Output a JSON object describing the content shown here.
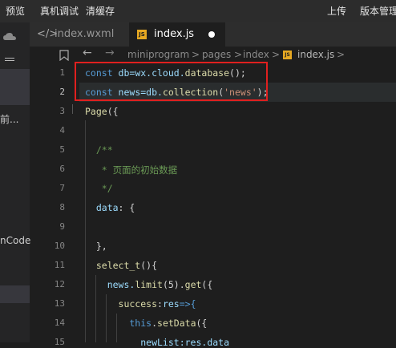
{
  "toolbar": {
    "preview": "预览",
    "remote_debug": "真机调试",
    "clear_cache": "清缓存",
    "upload": "上传",
    "version": "版本管理"
  },
  "left_panel": {
    "item1": "前...",
    "item2": "nCode"
  },
  "tabs": [
    {
      "label": "index.wxml",
      "icon": "wxml-file-icon"
    },
    {
      "label": "index.js",
      "icon": "js-file-icon",
      "active": true
    }
  ],
  "breadcrumb": {
    "segments": [
      "miniprogram",
      "pages",
      "index",
      "index.js"
    ],
    "sep": ">",
    "tail": ">"
  },
  "code": {
    "lines": [
      {
        "n": "1",
        "tokens": [
          {
            "t": "const ",
            "c": "kw"
          },
          {
            "t": "db=wx.cloud.",
            "c": "var"
          },
          {
            "t": "database",
            "c": "fn"
          },
          {
            "t": "();",
            "c": ""
          }
        ]
      },
      {
        "n": "2",
        "tokens": [
          {
            "t": "const ",
            "c": "kw"
          },
          {
            "t": "news=db.",
            "c": "var"
          },
          {
            "t": "collection",
            "c": "fn"
          },
          {
            "t": "(",
            "c": ""
          },
          {
            "t": "'news'",
            "c": "str"
          },
          {
            "t": ");",
            "c": ""
          }
        ]
      },
      {
        "n": "3",
        "tokens": [
          {
            "t": "Page",
            "c": "fn"
          },
          {
            "t": "({",
            "c": ""
          }
        ]
      },
      {
        "n": "4",
        "tokens": []
      },
      {
        "n": "5",
        "tokens": [
          {
            "t": "  /**",
            "c": "com"
          }
        ]
      },
      {
        "n": "6",
        "tokens": [
          {
            "t": "   * 页面的初始数据",
            "c": "com"
          }
        ]
      },
      {
        "n": "7",
        "tokens": [
          {
            "t": "   */",
            "c": "com"
          }
        ]
      },
      {
        "n": "8",
        "tokens": [
          {
            "t": "  data",
            "c": "var"
          },
          {
            "t": ": {",
            "c": ""
          }
        ]
      },
      {
        "n": "9",
        "tokens": []
      },
      {
        "n": "10",
        "tokens": [
          {
            "t": "  },",
            "c": ""
          }
        ]
      },
      {
        "n": "11",
        "tokens": [
          {
            "t": "  select_t",
            "c": "fn"
          },
          {
            "t": "(){",
            "c": ""
          }
        ]
      },
      {
        "n": "12",
        "tokens": [
          {
            "t": "    news.",
            "c": "var"
          },
          {
            "t": "limit",
            "c": "fn"
          },
          {
            "t": "(5).",
            "c": ""
          },
          {
            "t": "get",
            "c": "fn"
          },
          {
            "t": "({",
            "c": ""
          }
        ]
      },
      {
        "n": "13",
        "tokens": [
          {
            "t": "      success",
            "c": "fn"
          },
          {
            "t": ":",
            "c": ""
          },
          {
            "t": "res",
            "c": "var"
          },
          {
            "t": "=>{",
            "c": "kw"
          }
        ]
      },
      {
        "n": "14",
        "tokens": [
          {
            "t": "        this",
            "c": "kw"
          },
          {
            "t": ".",
            "c": ""
          },
          {
            "t": "setData",
            "c": "fn"
          },
          {
            "t": "({",
            "c": ""
          }
        ]
      },
      {
        "n": "15",
        "tokens": [
          {
            "t": "          newList:res.data",
            "c": "var"
          }
        ]
      }
    ]
  }
}
